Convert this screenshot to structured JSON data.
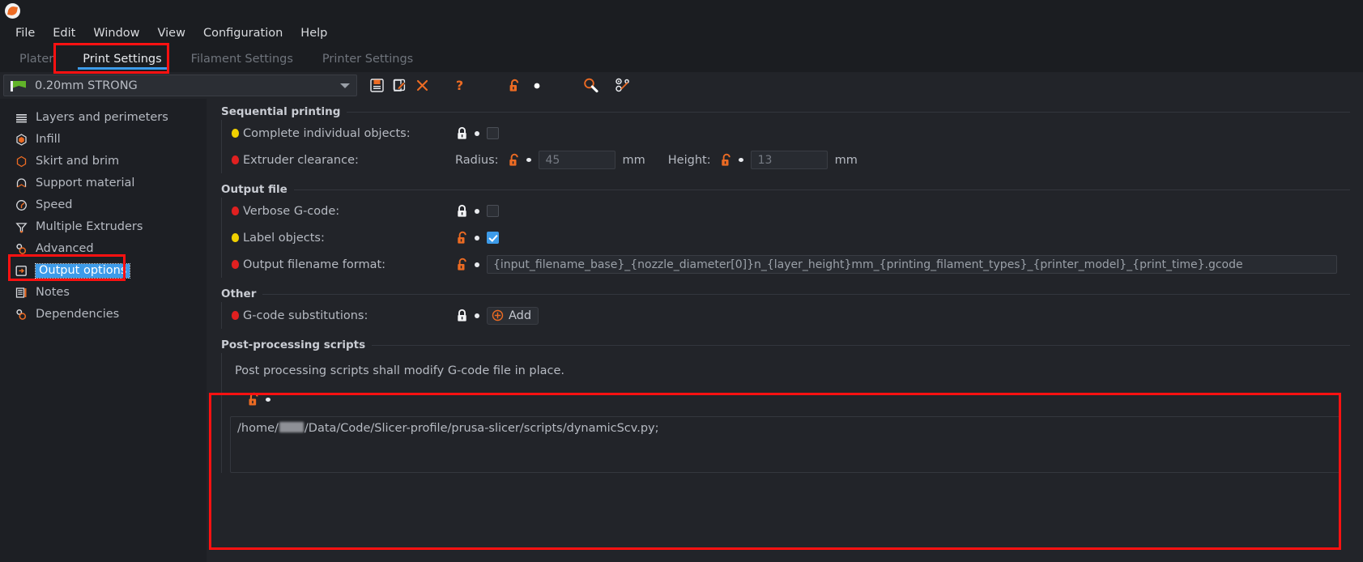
{
  "app": {
    "logo_icon": "prusaslicer-logo-icon",
    "menus": [
      "File",
      "Edit",
      "Window",
      "View",
      "Configuration",
      "Help"
    ]
  },
  "tabs": [
    {
      "label": "Plater",
      "active": false
    },
    {
      "label": "Print Settings",
      "active": true
    },
    {
      "label": "Filament Settings",
      "active": false
    },
    {
      "label": "Printer Settings",
      "active": false
    }
  ],
  "preset": {
    "name": "0.20mm STRONG",
    "flag_icon": "green-flag-icon",
    "dropdown_icon": "chevron-down-icon"
  },
  "toolbar": [
    {
      "name": "save-preset-button",
      "icon": "floppy-disk-icon"
    },
    {
      "name": "rename-preset-button",
      "icon": "pencil-square-icon"
    },
    {
      "name": "delete-preset-button",
      "icon": "x-cross-icon"
    },
    {
      "name": "help-button",
      "icon": "question-mark-icon"
    },
    {
      "name": "lock-toggle-button",
      "icon": "unlocked-orange-icon"
    },
    {
      "name": "revert-dot-button",
      "icon": "white-dot-icon"
    },
    {
      "name": "search-button",
      "icon": "magnifier-icon"
    },
    {
      "name": "compare-presets-button",
      "icon": "compare-ab-icon"
    }
  ],
  "sidebar": {
    "items": [
      {
        "label": "Layers and perimeters",
        "icon": "layers-icon",
        "selected": false
      },
      {
        "label": "Infill",
        "icon": "infill-hexagon-icon",
        "selected": false
      },
      {
        "label": "Skirt and brim",
        "icon": "skirt-ring-icon",
        "selected": false
      },
      {
        "label": "Support material",
        "icon": "support-arch-icon",
        "selected": false
      },
      {
        "label": "Speed",
        "icon": "speed-gauge-icon",
        "selected": false
      },
      {
        "label": "Multiple Extruders",
        "icon": "funnel-icon",
        "selected": false
      },
      {
        "label": "Advanced",
        "icon": "gears-icon",
        "selected": false
      },
      {
        "label": "Output options",
        "icon": "output-export-icon",
        "selected": true
      },
      {
        "label": "Notes",
        "icon": "notes-book-icon",
        "selected": false
      },
      {
        "label": "Dependencies",
        "icon": "gears-icon",
        "selected": false
      }
    ]
  },
  "main": {
    "groups": [
      {
        "title": "Sequential printing",
        "rows": [
          {
            "label": "Complete individual objects:",
            "bullet": "yellow",
            "lock": "locked-white",
            "control": "checkbox",
            "checked": false
          },
          {
            "label": "Extruder clearance:",
            "bullet": "red",
            "fields": [
              {
                "sublabel": "Radius:",
                "lock": "unlocked-orange",
                "value": "45",
                "unit": "mm"
              },
              {
                "sublabel": "Height:",
                "lock": "unlocked-orange",
                "value": "13",
                "unit": "mm"
              }
            ]
          }
        ]
      },
      {
        "title": "Output file",
        "rows": [
          {
            "label": "Verbose G-code:",
            "bullet": "red",
            "lock": "locked-white",
            "control": "checkbox",
            "checked": false
          },
          {
            "label": "Label objects:",
            "bullet": "yellow",
            "lock": "unlocked-orange",
            "control": "checkbox",
            "checked": true
          },
          {
            "label": "Output filename format:",
            "bullet": "red",
            "lock": "unlocked-orange",
            "control": "text",
            "value": "{input_filename_base}_{nozzle_diameter[0]}n_{layer_height}mm_{printing_filament_types}_{printer_model}_{print_time}.gcode"
          }
        ]
      },
      {
        "title": "Other",
        "rows": [
          {
            "label": "G-code substitutions:",
            "bullet": "red",
            "lock": "locked-white",
            "control": "button",
            "button_label": "Add",
            "button_icon": "plus-circle-icon"
          }
        ]
      }
    ],
    "postprocessing": {
      "title": "Post-processing scripts",
      "description": "Post processing scripts shall modify G-code file in place.",
      "lock": "unlocked-orange",
      "script_prefix": "/home/",
      "script_redacted": true,
      "script_suffix": "/Data/Code/Slicer-profile/prusa-slicer/scripts/dynamicScv.py;"
    }
  },
  "annotations": {
    "highlight_color": "#ff1111",
    "boxes": [
      "print-settings-tab",
      "output-options-sidebar-item",
      "post-processing-scripts-group"
    ]
  },
  "colors": {
    "accent_blue": "#3d9be9",
    "accent_orange": "#ec6b23",
    "bg_dark": "#1b1d21",
    "bg_panel": "#222429",
    "bg_sidebar": "#1d1f24",
    "modified_yellow": "#f0d000",
    "system_red": "#e02020"
  }
}
